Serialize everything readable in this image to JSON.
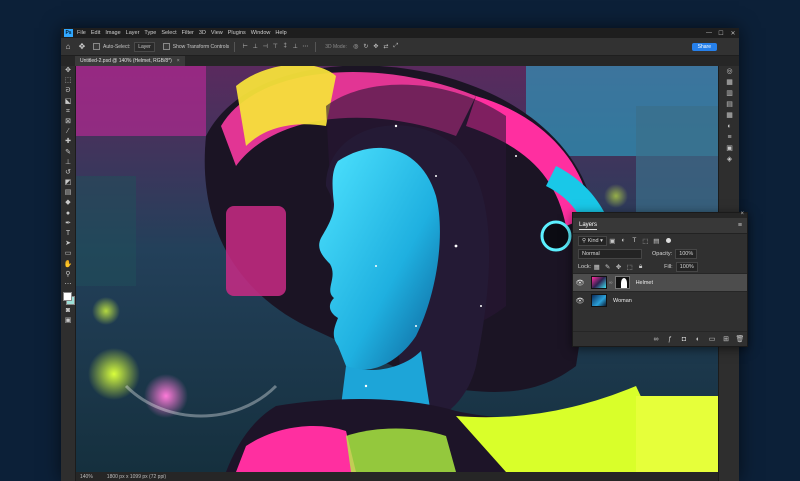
{
  "app": {
    "logo": "Ps",
    "menus": [
      "File",
      "Edit",
      "Image",
      "Layer",
      "Type",
      "Select",
      "Filter",
      "3D",
      "View",
      "Plugins",
      "Window",
      "Help"
    ],
    "window_controls": [
      "—",
      "☐",
      "✕"
    ]
  },
  "options_bar": {
    "home_icon": "home-icon",
    "move_icon": "move-tool-icon",
    "auto_select_label": "Auto-Select:",
    "auto_select_value": "Layer",
    "show_transform_label": "Show Transform Controls",
    "mode_3d_label": "3D Mode:",
    "share_label": "Share"
  },
  "document": {
    "tab_title": "Untitled-2.psd @ 140% (Helmet, RGB/8*)",
    "zoom": "140%",
    "dimensions": "1800 px x 1099 px (72 ppi)"
  },
  "layers_panel": {
    "title": "Layers",
    "filter_value": "Kind",
    "blend_mode": "Normal",
    "opacity_label": "Opacity:",
    "opacity_value": "100%",
    "lock_label": "Lock:",
    "fill_label": "Fill:",
    "fill_value": "100%",
    "layers": [
      {
        "name": "Helmet",
        "selected": true
      },
      {
        "name": "Woman",
        "selected": false
      }
    ]
  },
  "colors": {
    "accent": "#2680eb",
    "foreground_swatch": "#ffffff",
    "background_swatch": "#9de0d8"
  }
}
